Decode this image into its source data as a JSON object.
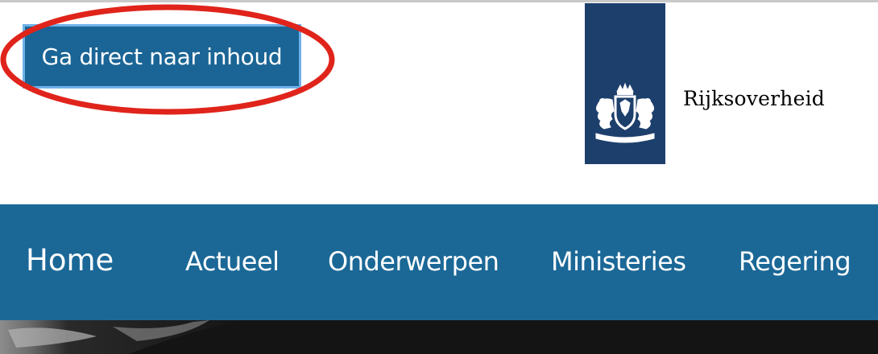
{
  "skip_link": {
    "label": "Ga direct naar inhoud"
  },
  "logo": {
    "text": "Rijksoverheid",
    "emblem_icon": "coat-of-arms-icon",
    "ribbon_color": "#1d3f6c"
  },
  "nav": {
    "background_color": "#1b6897",
    "items": [
      {
        "label": "Home"
      },
      {
        "label": "Actueel"
      },
      {
        "label": "Onderwerpen"
      },
      {
        "label": "Ministeries"
      },
      {
        "label": "Regering"
      }
    ]
  },
  "annotation": {
    "shape": "ellipse",
    "color": "#e0241b"
  },
  "colors": {
    "skip_link_bg": "#1a6595",
    "skip_link_border": "#6fb1ea"
  }
}
